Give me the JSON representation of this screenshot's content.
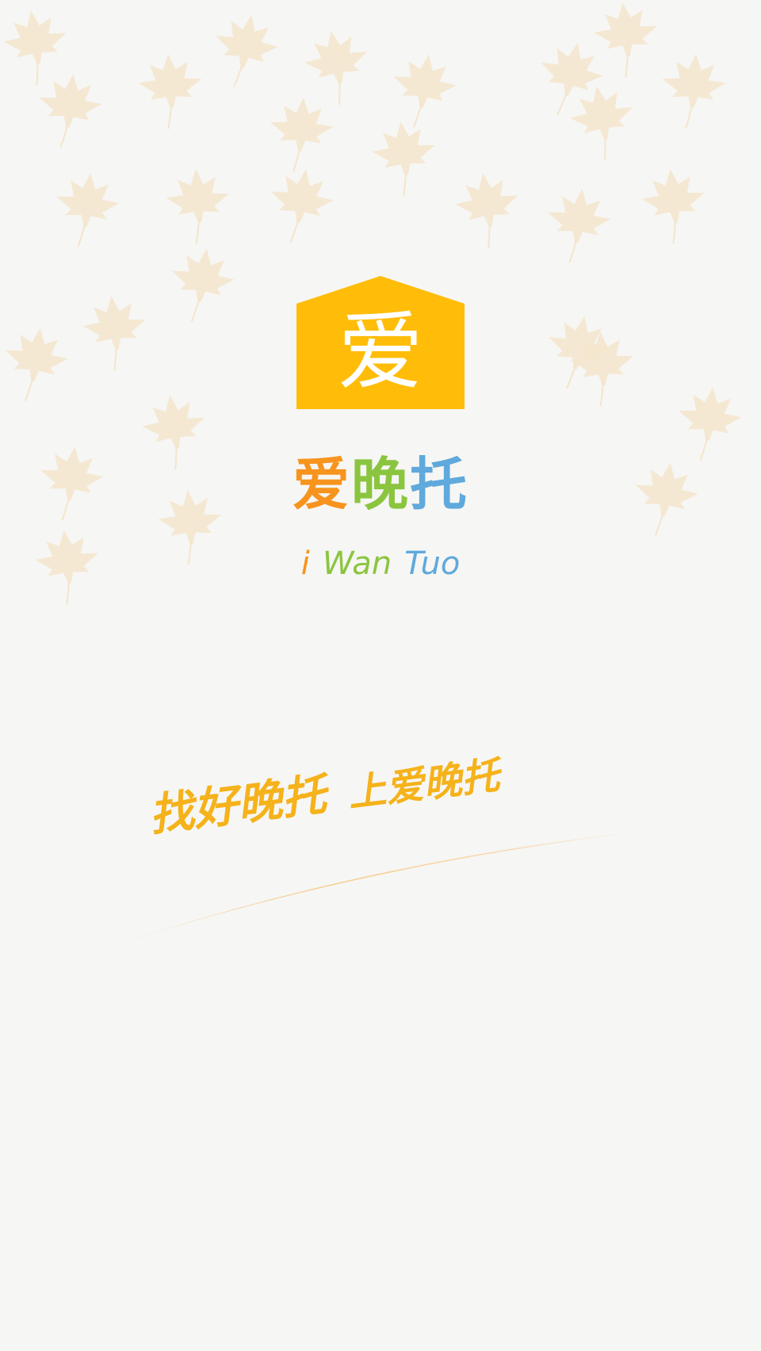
{
  "colors": {
    "background": "#f6f6f4",
    "leaf": "#f4e5cc",
    "logo_house": "#ffbd0a",
    "logo_text": "#ffffff",
    "name_orange": "#f7941d",
    "name_green": "#8bc540",
    "name_blue": "#5fa9dc",
    "slogan": "#f5b21a",
    "swoosh": "#f7c98a"
  },
  "logo": {
    "char": "爱",
    "icon": "house-logo-icon"
  },
  "app_name": {
    "char1": "爱",
    "char2": "晚",
    "char3": "托"
  },
  "app_name_roman": {
    "part1": "i",
    "part2": "Wan",
    "part3": "Tuo"
  },
  "slogan": {
    "part1": "找好晚托",
    "part2": "上爱晚托"
  },
  "decorations": {
    "background": "maple-leaf-icon",
    "underline": "swoosh-stroke"
  }
}
